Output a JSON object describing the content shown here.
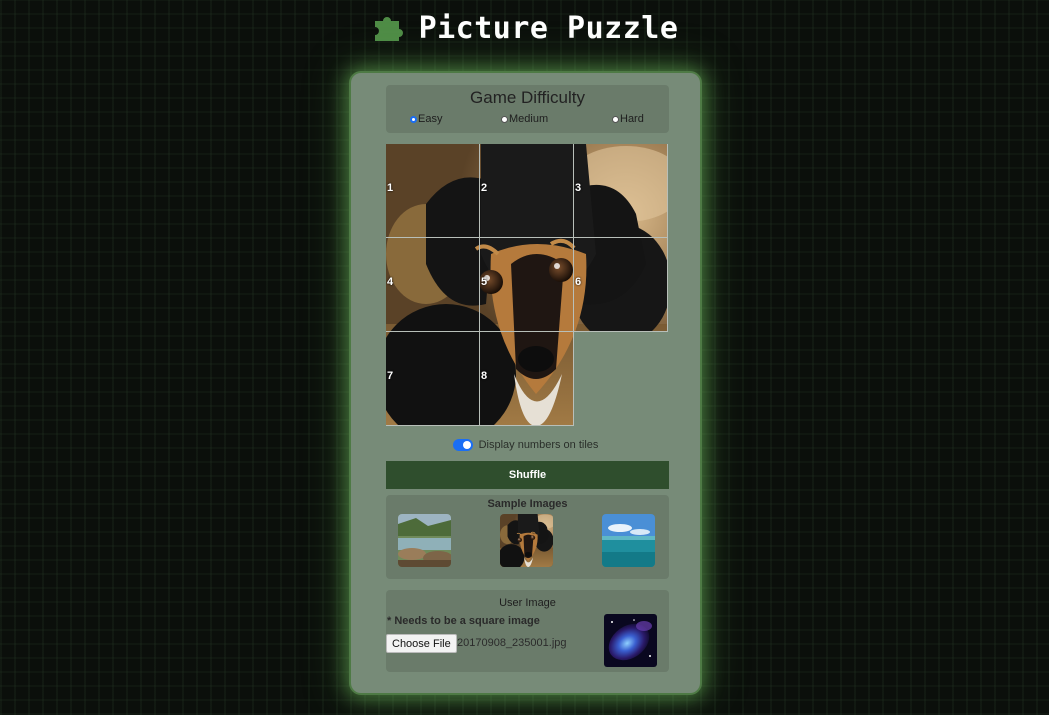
{
  "header": {
    "title": "Picture Puzzle",
    "logo_icon": "puzzle-piece-icon"
  },
  "difficulty": {
    "title": "Game Difficulty",
    "options": [
      {
        "label": "Easy",
        "selected": true
      },
      {
        "label": "Medium",
        "selected": false
      },
      {
        "label": "Hard",
        "selected": false
      }
    ]
  },
  "board": {
    "tiles": [
      "1",
      "2",
      "3",
      "4",
      "5",
      "6",
      "7",
      "8"
    ]
  },
  "toggle": {
    "label": "Display numbers on tiles",
    "on": true
  },
  "shuffle": {
    "label": "Shuffle"
  },
  "samples": {
    "title": "Sample Images"
  },
  "user_image": {
    "title": "User Image",
    "note": "* Needs to be a square image",
    "choose_label": "Choose File",
    "file_name": "20170908_235001.jpg"
  },
  "colors": {
    "accent": "#1a6ef5",
    "button": "#2f4e2d",
    "panel": "#778b78",
    "section": "#6a7b6a"
  }
}
